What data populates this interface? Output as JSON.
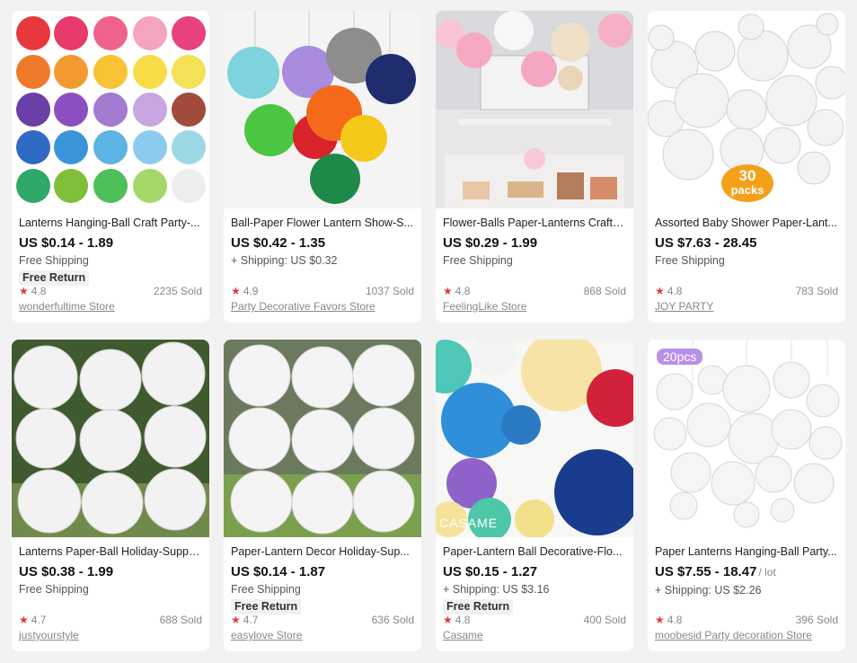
{
  "products": [
    {
      "title": "Lanterns Hanging-Ball Craft Party-...",
      "price": "US $0.14 - 1.89",
      "unit": "",
      "shipping": "Free Shipping",
      "free_return": "Free Return",
      "rating": "4.8",
      "sold": "2235 Sold",
      "store": "wonderfultime Store"
    },
    {
      "title": "Ball-Paper Flower Lantern Show-S...",
      "price": "US $0.42 - 1.35",
      "unit": "",
      "shipping": "+ Shipping: US $0.32",
      "free_return": "",
      "rating": "4.9",
      "sold": "1037 Sold",
      "store": "Party Decorative Favors Store"
    },
    {
      "title": "Flower-Balls Paper-Lanterns Crafts...",
      "price": "US $0.29 - 1.99",
      "unit": "",
      "shipping": "Free Shipping",
      "free_return": "",
      "rating": "4.8",
      "sold": "868 Sold",
      "store": "FeelingLike Store"
    },
    {
      "title": "Assorted Baby Shower Paper-Lant...",
      "price": "US $7.63 - 28.45",
      "unit": "",
      "shipping": "Free Shipping",
      "free_return": "",
      "rating": "4.8",
      "sold": "783 Sold",
      "store": "JOY PARTY",
      "image_tag_top": "30",
      "image_tag_bottom": "packs"
    },
    {
      "title": "Lanterns Paper-Ball Holiday-Suppli...",
      "price": "US $0.38 - 1.99",
      "unit": "",
      "shipping": "Free Shipping",
      "free_return": "",
      "rating": "4.7",
      "sold": "688 Sold",
      "store": "justyourstyle"
    },
    {
      "title": "Paper-Lantern Decor Holiday-Sup...",
      "price": "US $0.14 - 1.87",
      "unit": "",
      "shipping": "Free Shipping",
      "free_return": "Free Return",
      "rating": "4.7",
      "sold": "636 Sold",
      "store": "easylove Store"
    },
    {
      "title": "Paper-Lantern Ball Decorative-Flo...",
      "price": "US $0.15 - 1.27",
      "unit": "",
      "shipping": "+ Shipping: US $3.16",
      "free_return": "Free Return",
      "rating": "4.8",
      "sold": "400 Sold",
      "store": "Casame",
      "image_watermark": "CASAME"
    },
    {
      "title": "Paper Lanterns Hanging-Ball Party...",
      "price": "US $7.55 - 18.47",
      "unit": "/ lot",
      "shipping": "+ Shipping: US $2.26",
      "free_return": "",
      "rating": "4.8",
      "sold": "396 Sold",
      "store": "moobesid Party decoration Store",
      "image_tag": "20pcs"
    }
  ],
  "colors": {
    "star": "#e6383f",
    "badge_bg": "#f1f1f1",
    "page_bg": "#f2f2f2"
  },
  "icons": {
    "rating": "star-icon"
  }
}
